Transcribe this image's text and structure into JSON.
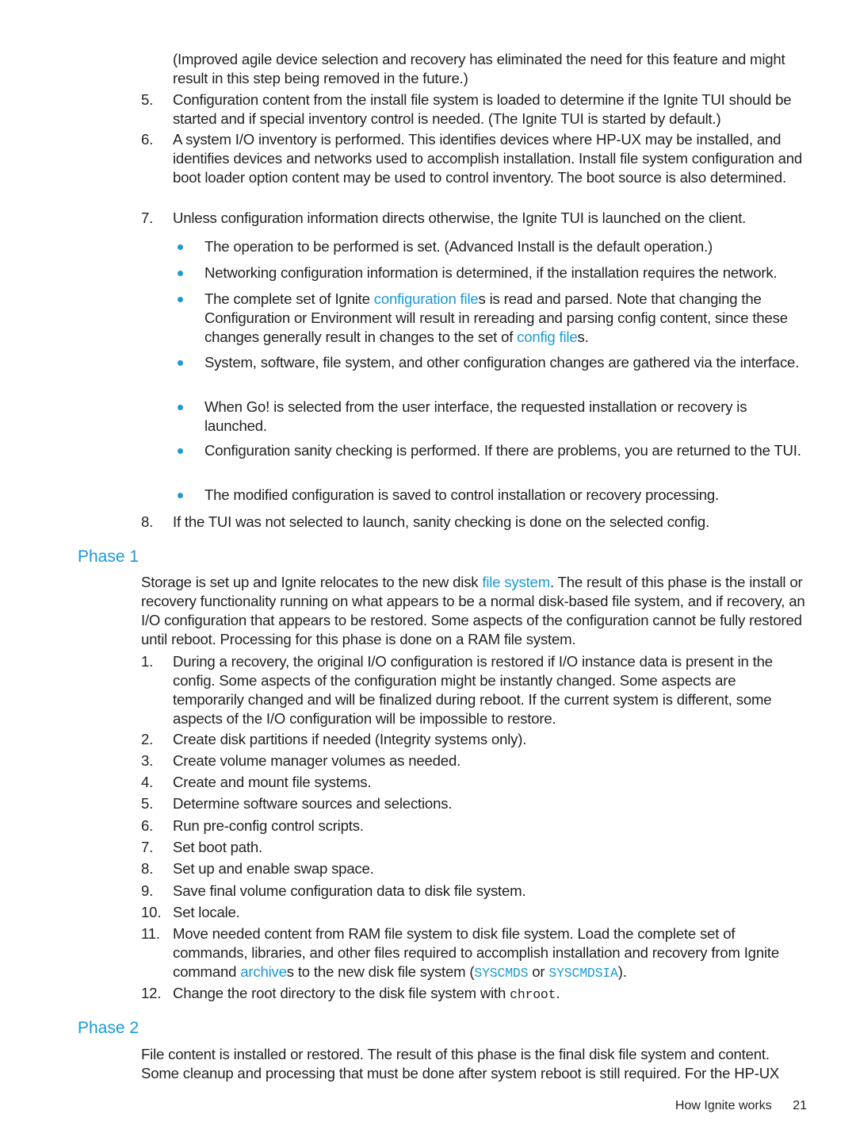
{
  "intro": {
    "continuation": "(Improved agile device selection and recovery has eliminated the need for this feature and might result in this step being removed in the future.)"
  },
  "steps_before": [
    {
      "num": "5.",
      "text": "Configuration content from the install file system is loaded to determine if the Ignite TUI should be started and if special inventory control is needed. (The Ignite TUI is started by default.)"
    },
    {
      "num": "6.",
      "text": "A system I/O inventory is performed. This identifies devices where HP-UX may be installed, and identifies devices and networks used to accomplish installation. Install file system configuration and boot loader option content may be used to control inventory. The boot source is also determined."
    },
    {
      "num": "7.",
      "text": "Unless configuration information directs otherwise, the Ignite TUI is launched on the client."
    }
  ],
  "bullets": [
    {
      "text": "The operation to be performed is set. (Advanced Install is the default operation.)"
    },
    {
      "text": "Networking configuration information is determined, if the installation requires the network."
    },
    {
      "pre": "The complete set of Ignite ",
      "link1": "configuration file",
      "mid": "s is read and parsed. Note that changing the Configuration or Environment will result in rereading and parsing config content, since these changes generally result in changes to the set of ",
      "link2": "config file",
      "post": "s."
    },
    {
      "text": "System, software, file system, and other configuration changes are gathered via the interface."
    },
    {
      "text": "When Go! is selected from the user interface, the requested installation or recovery is launched."
    },
    {
      "text": "Configuration sanity checking is performed. If there are problems, you are returned to the TUI."
    },
    {
      "text": "The modified configuration is saved to control installation or recovery processing."
    }
  ],
  "step8": {
    "num": "8.",
    "text": "If the TUI was not selected to launch, sanity checking is done on the selected config."
  },
  "phase1": {
    "heading": "Phase 1",
    "intro_pre": "Storage is set up and Ignite relocates to the new disk ",
    "intro_link": "file system",
    "intro_post": ". The result of this phase is the install or recovery functionality running on what appears to be a normal disk-based file system, and if recovery, an I/O configuration that appears to be restored. Some aspects of the configuration cannot be fully restored until reboot. Processing for this phase is done on a RAM file system.",
    "steps": [
      {
        "num": "1.",
        "text": "During a recovery, the original I/O configuration is restored if I/O instance data is present in the config. Some aspects of the configuration might be instantly changed. Some aspects are temporarily changed and will be finalized during reboot. If the current system is different, some aspects of the I/O configuration will be impossible to restore."
      },
      {
        "num": "2.",
        "text": "Create disk partitions if needed (Integrity systems only)."
      },
      {
        "num": "3.",
        "text": "Create volume manager volumes as needed."
      },
      {
        "num": "4.",
        "text": "Create and mount file systems."
      },
      {
        "num": "5.",
        "text": "Determine software sources and selections."
      },
      {
        "num": "6.",
        "text": "Run pre-config control scripts."
      },
      {
        "num": "7.",
        "text": "Set boot path."
      },
      {
        "num": "8.",
        "text": "Set up and enable swap space."
      },
      {
        "num": "9.",
        "text": "Save final volume configuration data to disk file system."
      },
      {
        "num": "10.",
        "text": "Set locale."
      }
    ],
    "step11": {
      "num": "11.",
      "pre": "Move needed content from RAM file system to disk file system. Load the complete set of commands, libraries, and other files required to accomplish installation and recovery from Ignite command ",
      "link": "archive",
      "mid": "s to the new disk file system (",
      "code1": "SYSCMDS",
      "or": " or ",
      "code2": "SYSCMDSIA",
      "post": ")."
    },
    "step12": {
      "num": "12.",
      "pre": "Change the root directory to the disk file system with ",
      "code": "chroot",
      "post": "."
    }
  },
  "phase2": {
    "heading": "Phase 2",
    "intro": "File content is installed or restored. The result of this phase is the final disk file system and content. Some cleanup and processing that must be done after system reboot is still required. For the HP-UX"
  },
  "footer": {
    "section": "How Ignite works",
    "page_number": "21"
  },
  "colors": {
    "accent": "#1a9ad6",
    "text": "#231f20"
  }
}
